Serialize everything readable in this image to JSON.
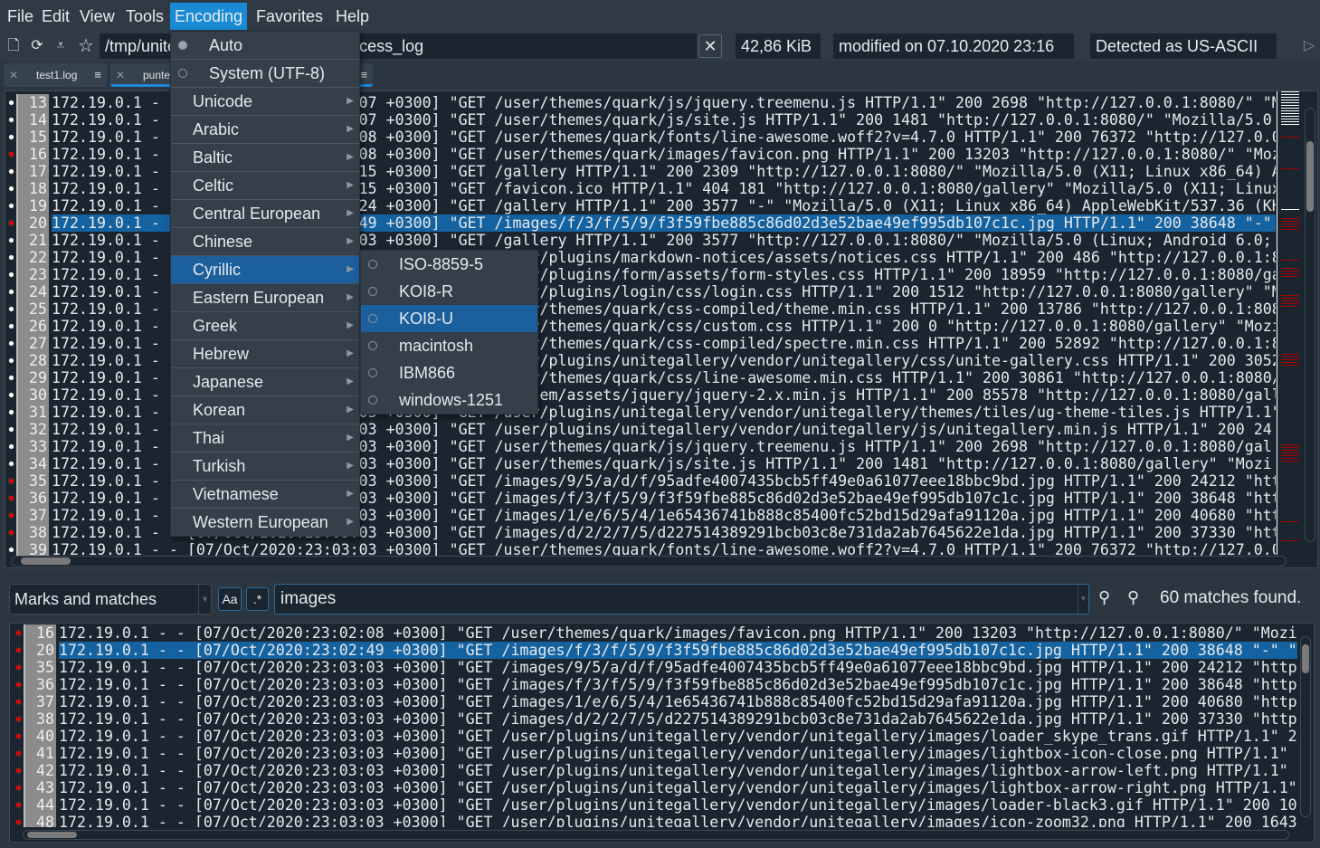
{
  "menubar": [
    "File",
    "Edit",
    "View",
    "Tools",
    "Encoding",
    "Favorites",
    "Help"
  ],
  "toolbar": {
    "path": "/tmp/unitegallery_test/logs/nginx/access_log",
    "path_visible_start": "/tmp/unit",
    "path_visible_end": "allery_test/logs/nginx/access_log",
    "size": "42,86 KiB",
    "modified": "modified on 07.10.2020 23:16",
    "detected": "Detected as US-ASCII",
    "icons": [
      "open-file-icon",
      "reload-file-icon",
      "filter-icon",
      "favorite-star-icon",
      "clear-icon",
      "next-arrow-icon"
    ]
  },
  "tabs": [
    {
      "label": "test1.log"
    },
    {
      "label": "punte",
      "active": true
    }
  ],
  "encoding_menu": {
    "items": [
      {
        "label": "Auto",
        "radio": true,
        "checked": true
      },
      {
        "label": "System (UTF-8)",
        "radio": true
      },
      {
        "label": "Unicode",
        "sub": true
      },
      {
        "label": "Arabic",
        "sub": true
      },
      {
        "label": "Baltic",
        "sub": true
      },
      {
        "label": "Celtic",
        "sub": true
      },
      {
        "label": "Central European",
        "sub": true
      },
      {
        "label": "Chinese",
        "sub": true
      },
      {
        "label": "Cyrillic",
        "sub": true,
        "highlighted": true
      },
      {
        "label": "Eastern European",
        "sub": true
      },
      {
        "label": "Greek",
        "sub": true
      },
      {
        "label": "Hebrew",
        "sub": true
      },
      {
        "label": "Japanese",
        "sub": true
      },
      {
        "label": "Korean",
        "sub": true
      },
      {
        "label": "Thai",
        "sub": true
      },
      {
        "label": "Turkish",
        "sub": true
      },
      {
        "label": "Vietnamese",
        "sub": true
      },
      {
        "label": "Western European",
        "sub": true
      }
    ],
    "cyrillic_submenu": [
      {
        "label": "ISO-8859-5"
      },
      {
        "label": "KOI8-R"
      },
      {
        "label": "KOI8-U",
        "highlighted": true
      },
      {
        "label": "macintosh"
      },
      {
        "label": "IBM866"
      },
      {
        "label": "windows-1251"
      }
    ]
  },
  "main_lines": [
    {
      "n": 13,
      "t": "172.19.0.1 - - [07/Oct/2020:23:02:07 +0300] \"GET /user/themes/quark/js/jquery.treemenu.js HTTP/1.1\" 200 2698 \"http://127.0.0.1:8080/\" \"M"
    },
    {
      "n": 14,
      "t": "172.19.0.1 - - [07/Oct/2020:23:02:07 +0300] \"GET /user/themes/quark/js/site.js HTTP/1.1\" 200 1481 \"http://127.0.0.1:8080/\" \"Mozilla/5.0 "
    },
    {
      "n": 15,
      "t": "172.19.0.1 - - [07/Oct/2020:23:02:08 +0300] \"GET /user/themes/quark/fonts/line-awesome.woff2?v=4.7.0 HTTP/1.1\" 200 76372 \"http://127.0.0"
    },
    {
      "n": 16,
      "t": "172.19.0.1 - - [07/Oct/2020:23:02:08 +0300] \"GET /user/themes/quark/images/favicon.png HTTP/1.1\" 200 13203 \"http://127.0.0.1:8080/\" \"Moz",
      "mark": true
    },
    {
      "n": 17,
      "t": "172.19.0.1 - - [07/Oct/2020:23:02:15 +0300] \"GET /gallery HTTP/1.1\" 200 2309 \"http://127.0.0.1:8080/\" \"Mozilla/5.0 (X11; Linux x86_64) A"
    },
    {
      "n": 18,
      "t": "172.19.0.1 - - [07/Oct/2020:23:02:15 +0300] \"GET /favicon.ico HTTP/1.1\" 404 181 \"http://127.0.0.1:8080/gallery\" \"Mozilla/5.0 (X11; Linux"
    },
    {
      "n": 19,
      "t": "172.19.0.1 - - [07/Oct/2020:23:02:24 +0300] \"GET /gallery HTTP/1.1\" 200 3577 \"-\" \"Mozilla/5.0 (X11; Linux x86_64) AppleWebKit/537.36 (KH"
    },
    {
      "n": 20,
      "t": "172.19.0.1 - - [07/Oct/2020:23:02:49 +0300] \"GET /images/f/3/f/5/9/f3f59fbe885c86d02d3e52bae49ef995db107c1c.jpg HTTP/1.1\" 200 38648 \"-\" \"M",
      "mark": true,
      "selected": true
    },
    {
      "n": 21,
      "t": "172.19.0.1 - - [07/Oct/2020:23:03:03 +0300] \"GET /gallery HTTP/1.1\" 200 3577 \"http://127.0.0.1:8080/\" \"Mozilla/5.0 (Linux; Android 6.0;"
    },
    {
      "n": 22,
      "t": "172.19.0.1 - - [07/Oct/2020:23:03:03 +0300] \"GET /user/plugins/markdown-notices/assets/notices.css HTTP/1.1\" 200 486 \"http://127.0.0.1:8"
    },
    {
      "n": 23,
      "t": "172.19.0.1 - - [07/Oct/2020:23:03:03 +0300] \"GET /user/plugins/form/assets/form-styles.css HTTP/1.1\" 200 18959 \"http://127.0.0.1:8080/ga"
    },
    {
      "n": 24,
      "t": "172.19.0.1 - - [07/Oct/2020:23:03:03 +0300] \"GET /user/plugins/login/css/login.css HTTP/1.1\" 200 1512 \"http://127.0.0.1:8080/gallery\" \"M"
    },
    {
      "n": 25,
      "t": "172.19.0.1 - - [07/Oct/2020:23:03:03 +0300] \"GET /user/themes/quark/css-compiled/theme.min.css HTTP/1.1\" 200 13786 \"http://127.0.0.1:808"
    },
    {
      "n": 26,
      "t": "172.19.0.1 - - [07/Oct/2020:23:03:03 +0300] \"GET /user/themes/quark/css/custom.css HTTP/1.1\" 200 0 \"http://127.0.0.1:8080/gallery\" \"Mozi"
    },
    {
      "n": 27,
      "t": "172.19.0.1 - - [07/Oct/2020:23:03:03 +0300] \"GET /user/themes/quark/css-compiled/spectre.min.css HTTP/1.1\" 200 52892 \"http://127.0.0.1:8"
    },
    {
      "n": 28,
      "t": "172.19.0.1 - - [07/Oct/2020:23:03:03 +0300] \"GET /user/plugins/unitegallery/vendor/unitegallery/css/unite-gallery.css HTTP/1.1\" 200 3052"
    },
    {
      "n": 29,
      "t": "172.19.0.1 - - [07/Oct/2020:23:03:03 +0300] \"GET /user/themes/quark/css/line-awesome.min.css HTTP/1.1\" 200 30861 \"http://127.0.0.1:8080/"
    },
    {
      "n": 30,
      "t": "172.19.0.1 - - [07/Oct/2020:23:03:03 +0300] \"GET /system/assets/jquery/jquery-2.x.min.js HTTP/1.1\" 200 85578 \"http://127.0.0.1:8080/gall"
    },
    {
      "n": 31,
      "t": "172.19.0.1 - - [07/Oct/2020:23:03:03 +0300] \"GET /user/plugins/unitegallery/vendor/unitegallery/themes/tiles/ug-theme-tiles.js HTTP/1.1\""
    },
    {
      "n": 32,
      "t": "172.19.0.1 - - [07/Oct/2020:23:03:03 +0300] \"GET /user/plugins/unitegallery/vendor/unitegallery/js/unitegallery.min.js HTTP/1.1\" 200 24"
    },
    {
      "n": 33,
      "t": "172.19.0.1 - - [07/Oct/2020:23:03:03 +0300] \"GET /user/themes/quark/js/jquery.treemenu.js HTTP/1.1\" 200 2698 \"http://127.0.0.1:8080/gal"
    },
    {
      "n": 34,
      "t": "172.19.0.1 - - [07/Oct/2020:23:03:03 +0300] \"GET /user/themes/quark/js/site.js HTTP/1.1\" 200 1481 \"http://127.0.0.1:8080/gallery\" \"Mozi"
    },
    {
      "n": 35,
      "t": "172.19.0.1 - - [07/Oct/2020:23:03:03 +0300] \"GET /images/9/5/a/d/f/95adfe4007435bcb5ff49e0a61077eee18bbc9bd.jpg HTTP/1.1\" 200 24212 \"htt",
      "mark": true
    },
    {
      "n": 36,
      "t": "172.19.0.1 - - [07/Oct/2020:23:03:03 +0300] \"GET /images/f/3/f/5/9/f3f59fbe885c86d02d3e52bae49ef995db107c1c.jpg HTTP/1.1\" 200 38648 \"htt",
      "mark": true
    },
    {
      "n": 37,
      "t": "172.19.0.1 - - [07/Oct/2020:23:03:03 +0300] \"GET /images/1/e/6/5/4/1e65436741b888c85400fc52bd15d29afa91120a.jpg HTTP/1.1\" 200 40680 \"htt",
      "mark": true
    },
    {
      "n": 38,
      "t": "172.19.0.1 - - [07/Oct/2020:23:03:03 +0300] \"GET /images/d/2/2/7/5/d227514389291bcb03c8e731da2ab7645622e1da.jpg HTTP/1.1\" 200 37330 \"htt",
      "mark": true
    },
    {
      "n": 39,
      "t": "172.19.0.1 - - [07/Oct/2020:23:03:03 +0300] \"GET /user/themes/quark/fonts/line-awesome.woff2?v=4.7.0 HTTP/1.1\" 200 76372 \"http://127.0.0"
    }
  ],
  "search": {
    "scope": "Marks and matches",
    "case_label": "Aa",
    "regex_label": ".*",
    "query": "images",
    "status": "60 matches found."
  },
  "match_lines": [
    {
      "n": 16,
      "t": "172.19.0.1 - - [07/Oct/2020:23:02:08 +0300] \"GET /user/themes/quark/images/favicon.png HTTP/1.1\" 200 13203 \"http://127.0.0.1:8080/\" \"Mozil"
    },
    {
      "n": 20,
      "t": "172.19.0.1 - - [07/Oct/2020:23:02:49 +0300] \"GET /images/f/3/f/5/9/f3f59fbe885c86d02d3e52bae49ef995db107c1c.jpg HTTP/1.1\" 200 38648 \"-\" \"M",
      "selected": true
    },
    {
      "n": 35,
      "t": "172.19.0.1 - - [07/Oct/2020:23:03:03 +0300] \"GET /images/9/5/a/d/f/95adfe4007435bcb5ff49e0a61077eee18bbc9bd.jpg HTTP/1.1\" 200 24212 \"http"
    },
    {
      "n": 36,
      "t": "172.19.0.1 - - [07/Oct/2020:23:03:03 +0300] \"GET /images/f/3/f/5/9/f3f59fbe885c86d02d3e52bae49ef995db107c1c.jpg HTTP/1.1\" 200 38648 \"http"
    },
    {
      "n": 37,
      "t": "172.19.0.1 - - [07/Oct/2020:23:03:03 +0300] \"GET /images/1/e/6/5/4/1e65436741b888c85400fc52bd15d29afa91120a.jpg HTTP/1.1\" 200 40680 \"http"
    },
    {
      "n": 38,
      "t": "172.19.0.1 - - [07/Oct/2020:23:03:03 +0300] \"GET /images/d/2/2/7/5/d227514389291bcb03c8e731da2ab7645622e1da.jpg HTTP/1.1\" 200 37330 \"http"
    },
    {
      "n": 40,
      "t": "172.19.0.1 - - [07/Oct/2020:23:03:03 +0300] \"GET /user/plugins/unitegallery/vendor/unitegallery/images/loader_skype_trans.gif HTTP/1.1\" 20"
    },
    {
      "n": 41,
      "t": "172.19.0.1 - - [07/Oct/2020:23:03:03 +0300] \"GET /user/plugins/unitegallery/vendor/unitegallery/images/lightbox-icon-close.png HTTP/1.1\" 2"
    },
    {
      "n": 42,
      "t": "172.19.0.1 - - [07/Oct/2020:23:03:03 +0300] \"GET /user/plugins/unitegallery/vendor/unitegallery/images/lightbox-arrow-left.png HTTP/1.1\" 2"
    },
    {
      "n": 43,
      "t": "172.19.0.1 - - [07/Oct/2020:23:03:03 +0300] \"GET /user/plugins/unitegallery/vendor/unitegallery/images/lightbox-arrow-right.png HTTP/1.1\""
    },
    {
      "n": 44,
      "t": "172.19.0.1 - - [07/Oct/2020:23:03:03 +0300] \"GET /user/plugins/unitegallery/vendor/unitegallery/images/loader-black3.gif HTTP/1.1\" 200 103"
    },
    {
      "n": 48,
      "t": "172.19.0.1 - - [07/Oct/2020:23:03:03 +0300] \"GET /user/plugins/unitegallery/vendor/unitegallery/images/icon-zoom32.png HTTP/1.1\" 200 1643"
    }
  ],
  "colors": {
    "selection": "#1562a0",
    "menu_open": "#1a8ad4",
    "mark": "#ee0000",
    "background": "#1b2530"
  }
}
